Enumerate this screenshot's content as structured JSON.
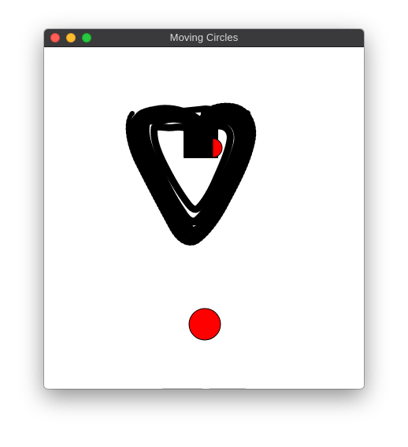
{
  "window": {
    "title": "Moving Circles"
  },
  "icons": {
    "close": "close-traffic-light",
    "minimize": "minimize-traffic-light",
    "maximize": "maximize-traffic-light"
  },
  "colors": {
    "circle_fill": "#ff0000",
    "trail": "#000000",
    "titlebar": "#3a3a3c"
  },
  "buttons": {
    "left_label": "",
    "right_label": ""
  }
}
